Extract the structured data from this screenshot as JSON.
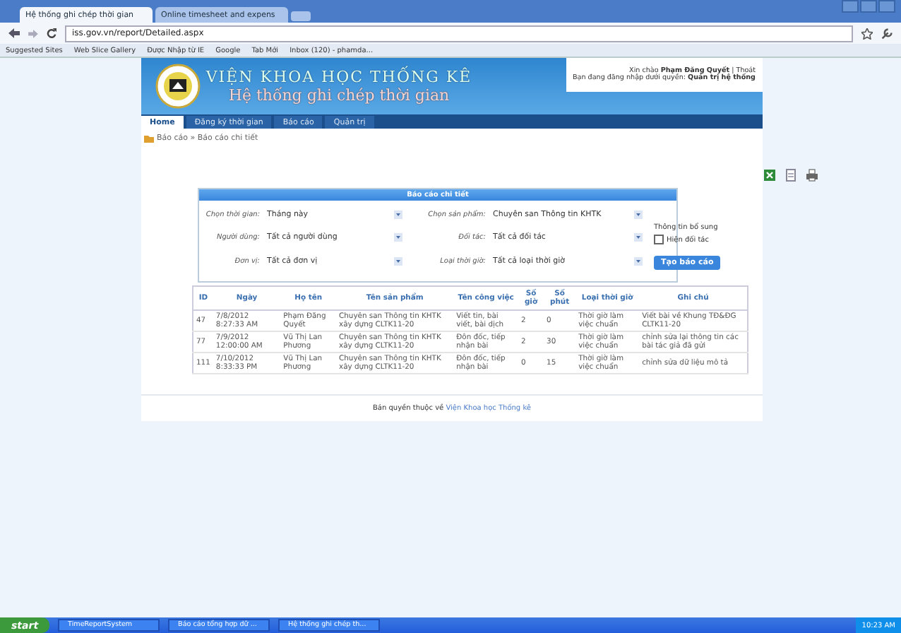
{
  "browser": {
    "tabs": [
      {
        "title": "Hệ thống ghi chép thời gian",
        "selected": true
      },
      {
        "title": "Online timesheet and expens",
        "selected": false
      }
    ],
    "url": "iss.gov.vn/report/Detailed.aspx",
    "bookmarks": [
      "Suggested Sites",
      "Web Slice Gallery",
      "Được Nhập từ IE",
      "Google",
      "Tab Mới",
      "Inbox (120) - phamda..."
    ]
  },
  "header": {
    "title": "VIỆN KHOA HỌC THỐNG KÊ",
    "subtitle": "Hệ thống ghi chép thời gian",
    "greeting": "Xin chào **Phạm Đăng Quyết** | Thoát",
    "role": "Bạn đang đăng nhập dưới quyền: **Quản trị hệ thống**"
  },
  "nav": [
    {
      "label": "Home",
      "selected": true
    },
    {
      "label": "Đăng ký thời gian",
      "selected": false
    },
    {
      "label": "Báo cáo",
      "selected": false
    },
    {
      "label": "Quản trị",
      "selected": false
    }
  ],
  "breadcrumb": "Báo cáo » Báo cáo chi tiết",
  "report": {
    "title": "Báo cáo chi tiết",
    "filters": [
      {
        "label": "Chọn thời gian:",
        "value": "Tháng này"
      },
      {
        "label": "Chọn sản phẩm:",
        "value": "Chuyên san Thông tin KHTK"
      },
      {
        "label": "Người dùng:",
        "value": "Tất cả người dùng"
      },
      {
        "label": "Đối tác:",
        "value": "Tất cả đối tác"
      },
      {
        "label": "Đơn vị:",
        "value": "Tất cả đơn vị"
      },
      {
        "label": "Loại thời giờ:",
        "value": "Tất cả loại thời giờ"
      }
    ],
    "extra_label": "Thông tin bổ sung",
    "show_partner": {
      "label": "Hiện đối tác",
      "checked": false
    },
    "button": "Tạo báo cáo"
  },
  "table": {
    "columns": [
      "ID",
      "Ngày",
      "Họ tên",
      "Tên sản phẩm",
      "Tên công việc",
      "Số giờ",
      "Số phút",
      "Loại thời giờ",
      "Ghi chú"
    ],
    "rows": [
      [
        "47",
        "7/8/2012 8:27:33 AM",
        "Phạm Đăng Quyết",
        "Chuyên san Thông tin KHTK xây dựng CLTK11-20",
        "Viết tin, bài viết, bài dịch",
        "2",
        "0",
        "Thời giờ làm việc chuẩn",
        "Viết bài về Khung TĐ&ĐG CLTK11-20"
      ],
      [
        "77",
        "7/9/2012 12:00:00 AM",
        "Vũ Thị Lan Phương",
        "Chuyên san Thông tin KHTK xây dựng CLTK11-20",
        "Đôn đốc, tiếp nhận bài",
        "2",
        "30",
        "Thời giờ làm việc chuẩn",
        "chỉnh sửa lại thông tin các bài tác giả đã gửi"
      ],
      [
        "111",
        "7/10/2012 8:33:33 PM",
        "Vũ Thị Lan Phương",
        "Chuyên san Thông tin KHTK xây dựng CLTK11-20",
        "Đôn đốc, tiếp nhận bài",
        "0",
        "15",
        "Thời giờ làm việc chuẩn",
        "chỉnh sửa dữ liệu mô tả"
      ]
    ]
  },
  "footer": {
    "text": "Bản quyền thuộc về",
    "link": "Viện Khoa học Thống kê"
  },
  "taskbar": {
    "start": "start",
    "items": [
      "TimeReportSystem",
      "Báo cáo tổng hợp dữ ...",
      "Hệ thống ghi chép th..."
    ],
    "clock": "10:23 AM"
  }
}
